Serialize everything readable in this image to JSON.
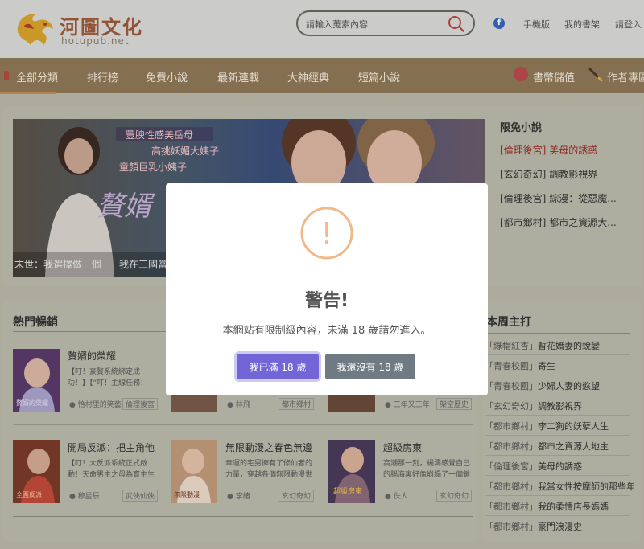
{
  "header": {
    "logo_title": "河圖文化",
    "logo_domain": "hotupub.net",
    "search_placeholder": "請輸入蒐索內容",
    "links": [
      "手機版",
      "我的書架",
      "請登入"
    ]
  },
  "nav": {
    "items": [
      "全部分類",
      "排行榜",
      "免費小說",
      "最新連載",
      "大神經典",
      "短篇小說"
    ],
    "right": [
      "書幣儲值",
      "作者專區"
    ]
  },
  "banner": {
    "overlay_lines": [
      "豐腴性感美岳母",
      "高挑妖媚大姨子",
      "童顏巨乳小姨子"
    ],
    "title_art": "贅婿",
    "captions": [
      "末世：我選擇做一個",
      "我在三國當"
    ]
  },
  "free_novels": {
    "title": "限免小說",
    "items": [
      {
        "cat": "[倫理後宮]",
        "name": "美母的誘惑"
      },
      {
        "cat": "[玄幻奇幻]",
        "name": "調教影視界"
      },
      {
        "cat": "[倫理後宮]",
        "name": "綜漫：從惡魔..."
      },
      {
        "cat": "[都市鄉村]",
        "name": "都市之資源大..."
      }
    ]
  },
  "hot": {
    "title": "熱門暢銷",
    "books": [
      {
        "title": "贅婿的榮耀",
        "desc": "【叮！豪贅系統綁定成功！】【“叮！主線任務：",
        "author": "恰村里的笑藝",
        "tag": "倫理後宮",
        "cover_color": "#5a3a6a"
      },
      {
        "title": "",
        "desc": "",
        "author": "林飛",
        "tag": "都市鄉村",
        "cover_color": "#7a5a4a"
      },
      {
        "title": "",
        "desc": "",
        "author": "三年又三年",
        "tag": "架空歷史",
        "cover_color": "#6a4a3a"
      },
      {
        "title": "開局反派：把主角他",
        "desc": "【叮！大反派系統正式啟動！天命男主之母為寶主生",
        "author": "穆星辰",
        "tag": "武俠仙俠",
        "cover_color": "#7a3a2a"
      },
      {
        "title": "無限動漫之春色無邊",
        "desc": "幸運的宅男擁有了修仙者的力量，穿越各個無限動漫世",
        "author": "李緒",
        "tag": "玄幻奇幻",
        "cover_color": "#c09a7a"
      },
      {
        "title": "超級房東",
        "desc": "高潮那一刻，楊濤感覺自己的腦海裏好像崩塌了一個鎖",
        "author": "佚人",
        "tag": "玄幻奇幻",
        "cover_color": "#4a3a5a"
      }
    ],
    "cover_texts": [
      "贅婿的榮耀",
      "全面反派",
      "無限動漫",
      "超級房東"
    ]
  },
  "weekly": {
    "title": "本周主打",
    "items": [
      {
        "cat": "「綠帽紅杏」",
        "name": "暫花嬌妻的蛻變"
      },
      {
        "cat": "「青春校園」",
        "name": "寄生"
      },
      {
        "cat": "「青春校園」",
        "name": "少婦人妻的慾望"
      },
      {
        "cat": "「玄幻奇幻」",
        "name": "調教影視界"
      },
      {
        "cat": "「都市鄉村」",
        "name": "李二狗的妖孽人生"
      },
      {
        "cat": "「都市鄉村」",
        "name": "都市之資源大地主"
      },
      {
        "cat": "「倫理後宮」",
        "name": "美母的誘惑"
      },
      {
        "cat": "「都市鄉村」",
        "name": "我當女性按摩師的那些年"
      },
      {
        "cat": "「都市鄉村」",
        "name": "我的柔情店長媽媽"
      },
      {
        "cat": "「都市鄉村」",
        "name": "豪門浪漫史"
      }
    ]
  },
  "modal": {
    "icon": "!",
    "title": "警告!",
    "text": "本網站有限制級內容，未滿 18 歲請勿進入。",
    "confirm": "我已滿 18 歲",
    "cancel": "我還沒有 18 歲",
    "accent": "#7266d6",
    "warn_color": "#f0b98a"
  }
}
